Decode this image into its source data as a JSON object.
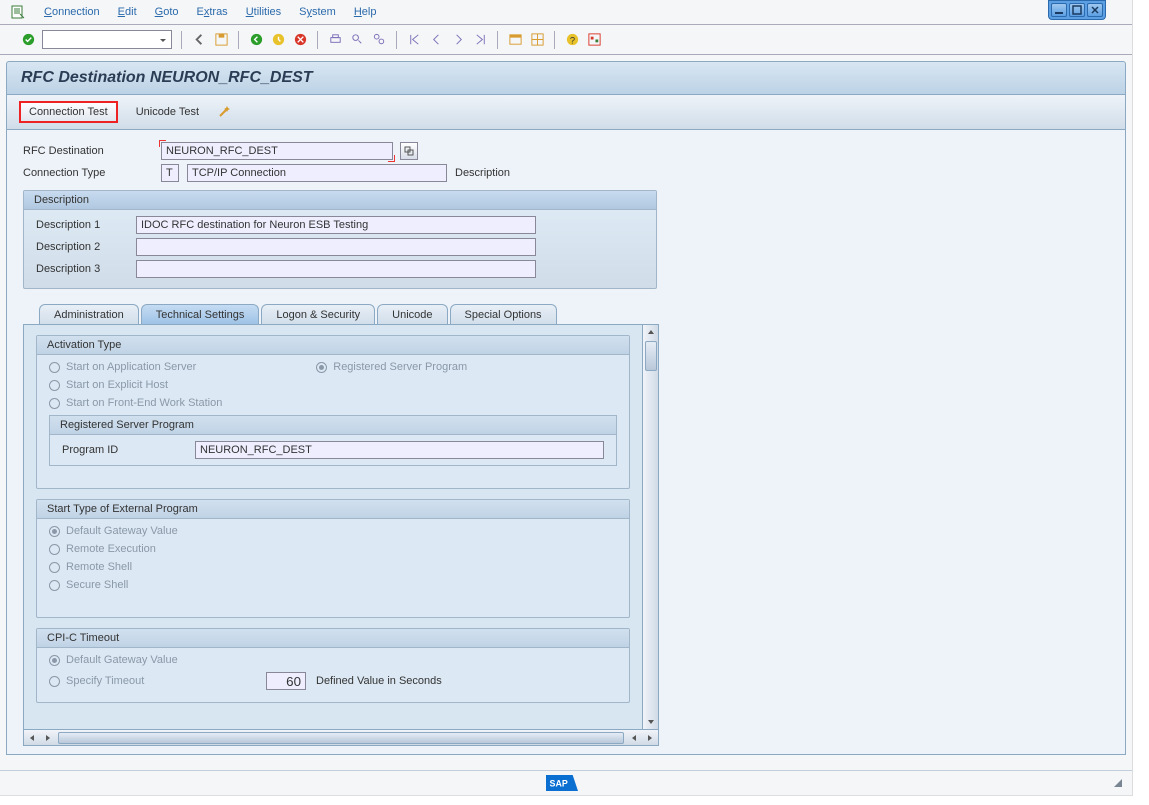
{
  "menu": {
    "connection": "Connection",
    "edit": "Edit",
    "goto": "Goto",
    "extras": "Extras",
    "utilities": "Utilities",
    "system": "System",
    "help": "Help"
  },
  "title": "RFC Destination NEURON_RFC_DEST",
  "actions": {
    "conn_test": "Connection Test",
    "unicode_test": "Unicode Test"
  },
  "fields": {
    "rfc_dest_label": "RFC Destination",
    "rfc_dest_value": "NEURON_RFC_DEST",
    "conn_type_label": "Connection Type",
    "conn_type_code": "T",
    "conn_type_value": "TCP/IP Connection",
    "description_label": "Description"
  },
  "desc_group": {
    "title": "Description",
    "d1_label": "Description 1",
    "d1_val": "IDOC RFC destination for Neuron ESB Testing",
    "d2_label": "Description 2",
    "d2_val": "",
    "d3_label": "Description 3",
    "d3_val": ""
  },
  "tabs": {
    "admin": "Administration",
    "tech": "Technical Settings",
    "logon": "Logon & Security",
    "unicode": "Unicode",
    "special": "Special Options"
  },
  "activation": {
    "title": "Activation Type",
    "start_app": "Start on Application Server",
    "registered": "Registered Server Program",
    "start_explicit": "Start on Explicit Host",
    "start_frontend": "Start on Front-End Work Station",
    "sub_title": "Registered Server Program",
    "prog_id_label": "Program ID",
    "prog_id_value": "NEURON_RFC_DEST"
  },
  "start_type": {
    "title": "Start Type of External Program",
    "default": "Default Gateway Value",
    "remote_exec": "Remote Execution",
    "remote_shell": "Remote Shell",
    "secure_shell": "Secure Shell"
  },
  "cpic": {
    "title": "CPI-C Timeout",
    "default": "Default Gateway Value",
    "specify": "Specify Timeout",
    "value": "60",
    "defined": "Defined Value in Seconds"
  }
}
